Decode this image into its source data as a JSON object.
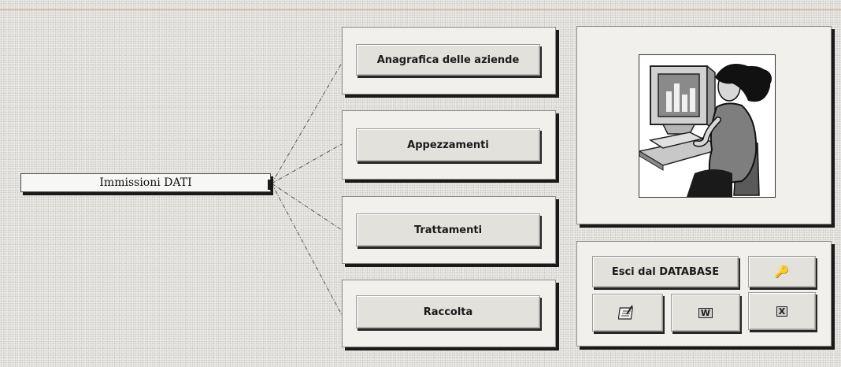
{
  "entry_label": "Immissioni DATI",
  "menu": {
    "anagrafica": "Anagrafica delle aziende",
    "appezzamenti": "Appezzamenti",
    "trattamenti": "Trattamenti",
    "raccolta": "Raccolta"
  },
  "actions": {
    "exit_label": "Esci dal DATABASE",
    "key_glyph": "🔑",
    "word_glyph": "W",
    "excel_glyph": "X"
  },
  "icons": {
    "key": "key-icon",
    "notepad": "notepad-icon",
    "word": "word-icon",
    "excel": "excel-icon",
    "illustration": "user-at-computer-illustration"
  },
  "colors": {
    "background": "#e9e8e4",
    "frame": "#f1f0ec",
    "button": "#e3e1dc",
    "shadow": "#1a1a1a"
  }
}
